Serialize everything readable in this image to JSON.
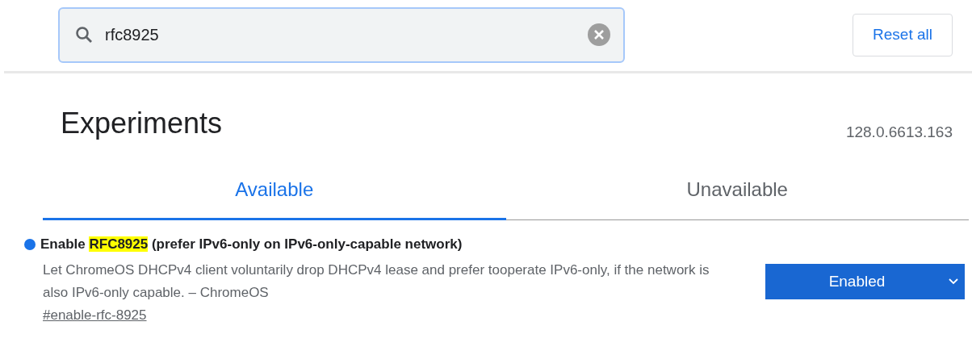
{
  "search": {
    "value": "rfc8925"
  },
  "reset_button": "Reset all",
  "heading": "Experiments",
  "version": "128.0.6613.163",
  "tabs": [
    {
      "label": "Available",
      "selected": true
    },
    {
      "label": "Unavailable",
      "selected": false
    }
  ],
  "experiments": [
    {
      "title": [
        {
          "text": "Enable ",
          "highlighted": false
        },
        {
          "text": "RFC8925",
          "highlighted": true
        },
        {
          "text": " (prefer IPv6-only on IPv6-only-capable network)",
          "highlighted": false
        }
      ],
      "modified": true,
      "description": "Let ChromeOS DHCPv4 client voluntarily drop DHCPv4 lease and prefer tooperate IPv6-only, if the network is also IPv6-only capable. – ChromeOS",
      "link": "#enable-rfc-8925",
      "state": "Enabled"
    }
  ]
}
